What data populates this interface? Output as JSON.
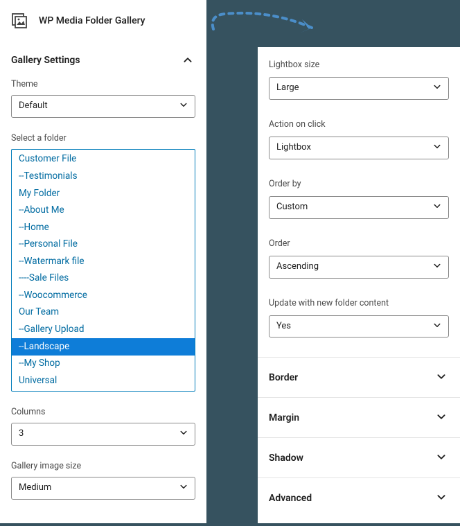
{
  "header": {
    "title": "WP Media Folder Gallery"
  },
  "gallery_settings": {
    "title": "Gallery Settings",
    "theme": {
      "label": "Theme",
      "value": "Default"
    },
    "select_folder": {
      "label": "Select a folder",
      "selected": "--Landscape",
      "items": [
        "Customer File",
        "--Testimonials",
        "My Folder",
        "--About Me",
        "--Home",
        "--Personal File",
        "--Watermark file",
        "----Sale Files",
        "--Woocommerce",
        "Our Team",
        "--Gallery Upload",
        "--Landscape",
        "--My Shop",
        "Universal"
      ]
    },
    "columns": {
      "label": "Columns",
      "value": "3"
    },
    "image_size": {
      "label": "Gallery image size",
      "value": "Medium"
    }
  },
  "right": {
    "lightbox_size": {
      "label": "Lightbox size",
      "value": "Large"
    },
    "action_on_click": {
      "label": "Action on click",
      "value": "Lightbox"
    },
    "order_by": {
      "label": "Order by",
      "value": "Custom"
    },
    "order": {
      "label": "Order",
      "value": "Ascending"
    },
    "update_folder": {
      "label": "Update with new folder content",
      "value": "Yes"
    },
    "accordion": {
      "border": "Border",
      "margin": "Margin",
      "shadow": "Shadow",
      "advanced": "Advanced"
    }
  }
}
